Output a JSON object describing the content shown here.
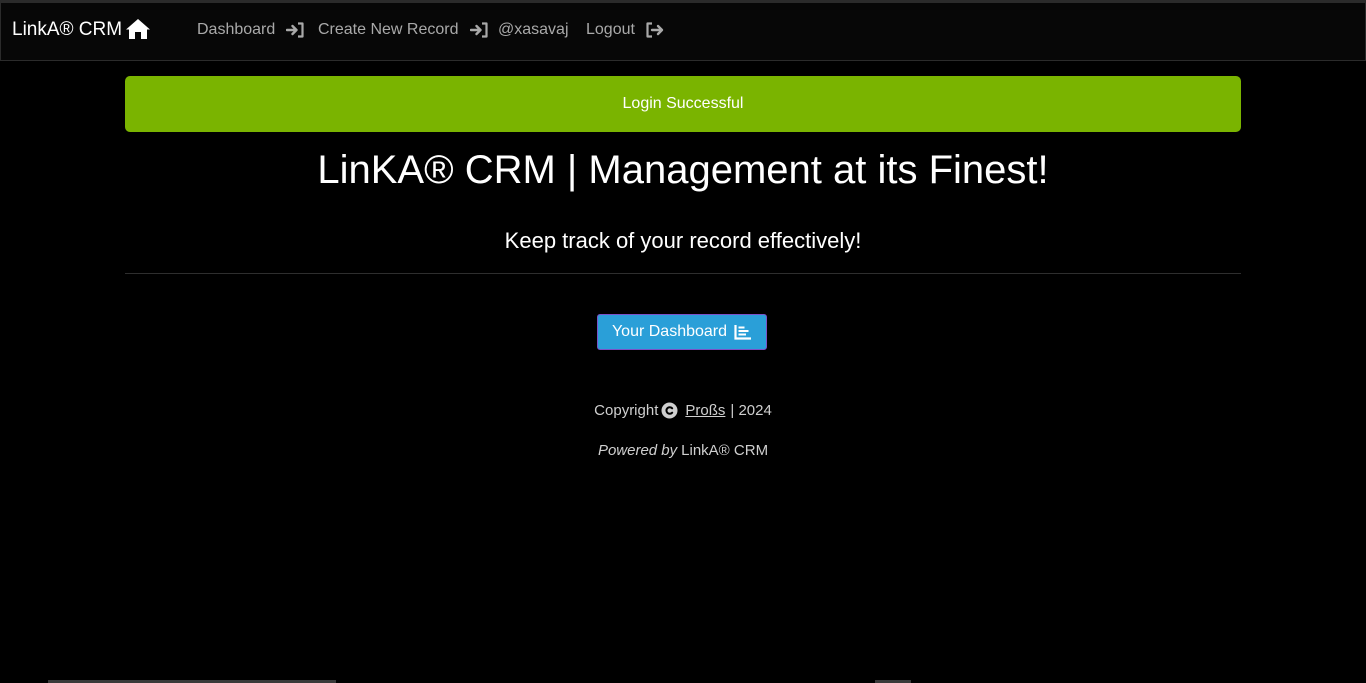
{
  "navbar": {
    "brand": "LinkA® CRM",
    "brand_icon": "home-icon",
    "links": [
      {
        "label": "Dashboard",
        "icon": "sign-in-icon"
      },
      {
        "label": "Create New Record",
        "icon": "sign-in-icon"
      },
      {
        "label": "@xasavaj"
      },
      {
        "label": "Logout",
        "icon": "sign-out-icon"
      }
    ]
  },
  "alert": {
    "message": "Login Successful",
    "color": "#7ab400"
  },
  "hero": {
    "title": "LinKA® CRM | Management at its Finest!",
    "subtitle": "Keep track of your record effectively!"
  },
  "dashboard_button": {
    "label": "Your Dashboard",
    "icon": "bar-chart-icon",
    "color": "#2a9fd8"
  },
  "footer": {
    "copyright_prefix": "Copyright",
    "copyright_icon": "copyright-icon",
    "author": "Proßs",
    "year_suffix": "| 2024",
    "powered_by": "Powered by",
    "powered_name": "LinkA® CRM"
  }
}
